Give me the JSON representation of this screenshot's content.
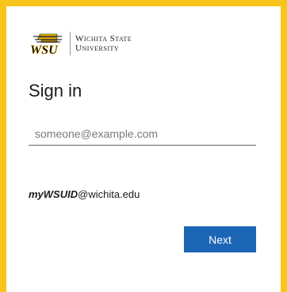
{
  "brand": {
    "logo_mark": "WSU",
    "name_line1": "Wichita State",
    "name_line2": "University",
    "accent_color": "#f8c51b",
    "dark_color": "#000000"
  },
  "signin": {
    "title": "Sign in",
    "email_placeholder": "someone@example.com",
    "email_value": "",
    "hint_id": "myWSUID",
    "hint_domain": "@wichita.edu",
    "next_label": "Next",
    "button_color": "#1b65b5"
  }
}
